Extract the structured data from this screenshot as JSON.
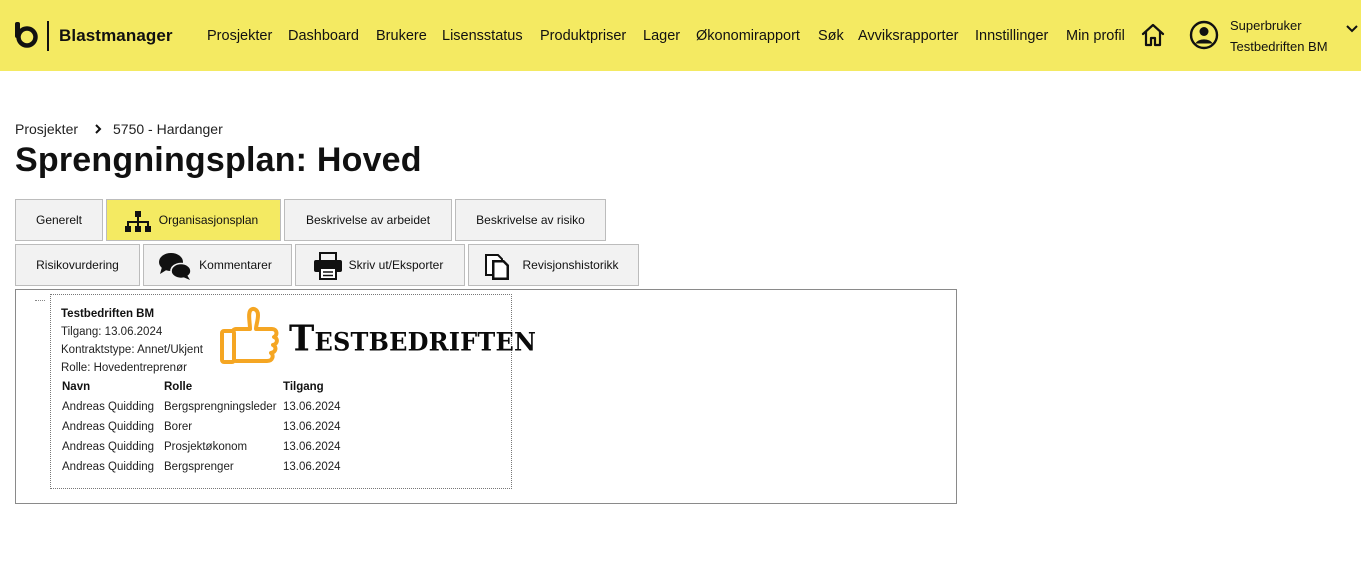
{
  "app": {
    "name": "Blastmanager"
  },
  "nav": [
    "Prosjekter",
    "Dashboard",
    "Brukere",
    "Lisensstatus",
    "Produktpriser",
    "Lager",
    "Økonomirapport",
    "Søk",
    "Avviksrapporter",
    "Innstillinger",
    "Min profil"
  ],
  "user": {
    "name": "Superbruker",
    "company": "Testbedriften BM"
  },
  "breadcrumb": [
    "Prosjekter",
    "5750 - Hardanger"
  ],
  "page_title": "Sprengningsplan: Hoved",
  "tabs_row1": [
    "Generelt",
    "Organisasjonsplan",
    "Beskrivelse av arbeidet",
    "Beskrivelse av risiko"
  ],
  "tabs_row2": [
    "Risikovurdering",
    "Kommentarer",
    "Skriv ut/Eksporter",
    "Revisjonshistorikk"
  ],
  "active_tab": "Organisasjonsplan",
  "org": {
    "company": "Testbedriften BM",
    "access_line": "Tilgang: 13.06.2024",
    "contract_line": "Kontraktstype: Annet/Ukjent",
    "role_line": "Rolle: Hovedentreprenør",
    "logo_text": "Testbedriften",
    "table_headers": [
      "Navn",
      "Rolle",
      "Tilgang"
    ],
    "rows": [
      [
        "Andreas Quidding",
        "Bergsprengningsleder",
        "13.06.2024"
      ],
      [
        "Andreas Quidding",
        "Borer",
        "13.06.2024"
      ],
      [
        "Andreas Quidding",
        "Prosjektøkonom",
        "13.06.2024"
      ],
      [
        "Andreas Quidding",
        "Bergsprenger",
        "13.06.2024"
      ]
    ]
  },
  "colors": {
    "accent": "#f4ea62",
    "tab_bg": "#f2f2f2",
    "thumb": "#f5a623"
  }
}
